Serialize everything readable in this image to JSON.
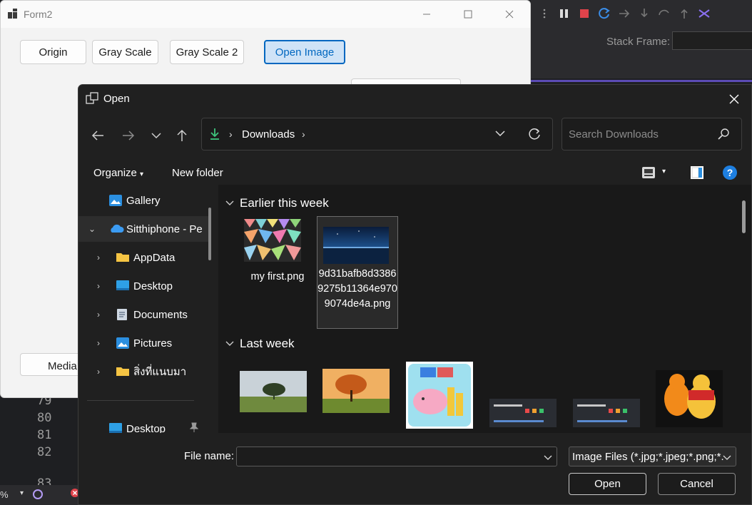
{
  "form2": {
    "title": "Form2",
    "buttons": {
      "origin": "Origin",
      "gray_scale": "Gray Scale",
      "gray_scale_2": "Gray Scale 2",
      "open_image": "Open Image",
      "media": "Media"
    }
  },
  "ide": {
    "stack_frame_label": "Stack Frame:",
    "line_numbers": [
      "79",
      "80",
      "81",
      "82",
      "83"
    ],
    "zoom": "%"
  },
  "dialog": {
    "title": "Open",
    "address": {
      "crumb": "Downloads"
    },
    "search_placeholder": "Search Downloads",
    "commands": {
      "organize": "Organize",
      "new_folder": "New folder"
    },
    "sidebar": [
      {
        "label": "Gallery",
        "icon": "gallery-icon",
        "expandable": false
      },
      {
        "label": "Sitthiphone - Pe",
        "icon": "onedrive-cloud-icon",
        "expandable": true,
        "expanded": true,
        "selected": true
      },
      {
        "label": "AppData",
        "icon": "folder-icon",
        "expandable": true
      },
      {
        "label": "Desktop",
        "icon": "desktop-icon",
        "expandable": true
      },
      {
        "label": "Documents",
        "icon": "documents-icon",
        "expandable": true
      },
      {
        "label": "Pictures",
        "icon": "pictures-icon",
        "expandable": true
      },
      {
        "label": "สิ่งที่แนบมา",
        "icon": "folder-icon",
        "expandable": true
      },
      {
        "label": "Desktop",
        "icon": "desktop-icon",
        "pinned": true
      }
    ],
    "groups": [
      {
        "header": "Earlier this week",
        "files": [
          {
            "name": "my first.png",
            "thumb": "colorful-geometric-thumbnail"
          },
          {
            "name": "9d31bafb8d33869275b11364e9709074de4a.png",
            "thumb": "night-lake-thumbnail",
            "selected": true
          }
        ]
      },
      {
        "header": "Last week",
        "files": [
          {
            "thumb": "tree-landscape-thumbnail"
          },
          {
            "thumb": "autumn-tree-thumbnail"
          },
          {
            "thumb": "piggy-bank-thumbnail"
          },
          {
            "thumb": "dark-card-thumbnail"
          },
          {
            "thumb": "dark-card-thumbnail"
          },
          {
            "thumb": "cartoon-bears-thumbnail"
          }
        ]
      }
    ],
    "footer": {
      "file_name_label": "File name:",
      "file_name_value": "",
      "filter": "Image Files (*.jpg;*.jpeg;*.png;*.",
      "open": "Open",
      "cancel": "Cancel"
    }
  }
}
